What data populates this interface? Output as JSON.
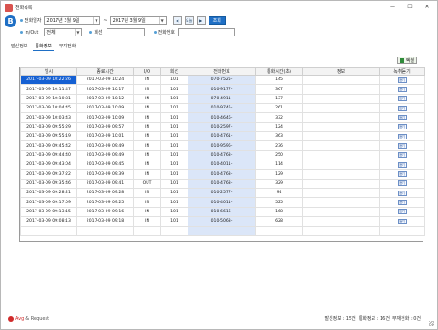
{
  "window": {
    "title": "전화목록",
    "min": "—",
    "max": "☐",
    "close": "✕"
  },
  "logo": {
    "glyph": "B"
  },
  "filter": {
    "date_label": "전화일자",
    "from": "2017년  3월  9일",
    "to": "2017년  3월  9일",
    "tilde": "~",
    "prev": "◀",
    "today": "오늘",
    "next": "▶",
    "search": "조회"
  },
  "options": {
    "inout_label": "In/Out",
    "inout_value": "전체",
    "line_label": "회선",
    "phone_label": "전화번호"
  },
  "tabs": [
    "발신정보",
    "통화정보",
    "부재전화"
  ],
  "active_tab": 1,
  "excel_label": "엑셀",
  "table": {
    "headers": [
      "일시",
      "종료시간",
      "I/O",
      "회선",
      "전화번호",
      "통화시간(초)",
      "정보",
      "녹취듣기"
    ],
    "rows": [
      [
        "2017-03-09 10:22:26",
        "2017-03-09 10:24",
        "IN",
        "101",
        "070-7525-",
        "145",
        "",
        "듣기"
      ],
      [
        "2017-03-09 10:11:47",
        "2017-03-09 10:17",
        "IN",
        "101",
        "010-9177-",
        "367",
        "",
        "듣기"
      ],
      [
        "2017-03-09 10:10:31",
        "2017-03-09 10:12",
        "IN",
        "101",
        "070-4911-",
        "137",
        "",
        "듣기"
      ],
      [
        "2017-03-09 10:04:45",
        "2017-03-09 10:09",
        "IN",
        "101",
        "010-9745-",
        "261",
        "",
        "듣기"
      ],
      [
        "2017-03-09 10:03:43",
        "2017-03-09 10:09",
        "IN",
        "101",
        "010-4646-",
        "332",
        "",
        "듣기"
      ],
      [
        "2017-03-09 09:55:29",
        "2017-03-09 09:57",
        "IN",
        "101",
        "010-2597-",
        "124",
        "",
        "듣기"
      ],
      [
        "2017-03-09 09:55:19",
        "2017-03-09 10:01",
        "IN",
        "101",
        "010-4761-",
        "363",
        "",
        "듣기"
      ],
      [
        "2017-03-09 09:45:42",
        "2017-03-09 09:49",
        "IN",
        "101",
        "010-9596-",
        "236",
        "",
        "듣기"
      ],
      [
        "2017-03-09 09:44:40",
        "2017-03-09 09:49",
        "IN",
        "101",
        "010-4763-",
        "250",
        "",
        "듣기"
      ],
      [
        "2017-03-09 09:43:04",
        "2017-03-09 09:45",
        "IN",
        "101",
        "010-4011-",
        "114",
        "",
        "듣기"
      ],
      [
        "2017-03-09 09:37:22",
        "2017-03-09 09:39",
        "IN",
        "101",
        "010-4763-",
        "129",
        "",
        "듣기"
      ],
      [
        "2017-03-09 09:35:46",
        "2017-03-09 09:41",
        "OUT",
        "101",
        "010-4763-",
        "329",
        "",
        "듣기"
      ],
      [
        "2017-03-09 09:28:21",
        "2017-03-09 09:28",
        "IN",
        "101",
        "010-2577-",
        "94",
        "",
        "듣기"
      ],
      [
        "2017-03-09 09:17:09",
        "2017-03-09 09:25",
        "IN",
        "101",
        "010-4011-",
        "525",
        "",
        "듣기"
      ],
      [
        "2017-03-09 09:13:15",
        "2017-03-09 09:16",
        "IN",
        "101",
        "010-6616-",
        "168",
        "",
        "듣기"
      ],
      [
        "2017-03-09 09:08:13",
        "2017-03-09 09:18",
        "IN",
        "101",
        "010-5063-",
        "628",
        "",
        "듣기"
      ]
    ],
    "empty_rows": 1,
    "selected_row": 0
  },
  "footer": {
    "brand": "Avg",
    "brand_sub": "& Request",
    "stats": [
      "발신정보 : 15건",
      "통화정보 : 16건",
      "부재전화 : 0건"
    ]
  },
  "colors": {
    "accent": "#1f6fc5",
    "selected": "#1560d3",
    "phone_col": "#dbe6f8"
  }
}
